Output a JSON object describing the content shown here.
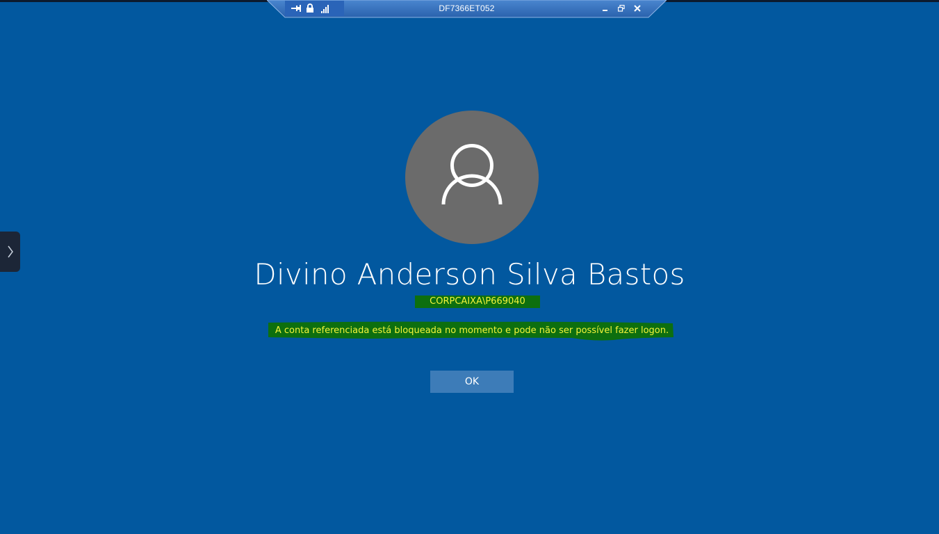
{
  "rdp_bar": {
    "title": "DF7366ET052",
    "icons": [
      "pin-icon",
      "lock-icon",
      "signal-icon",
      "minimize-icon",
      "restore-icon",
      "close-icon"
    ]
  },
  "login": {
    "user_name": "Divino Anderson Silva Bastos",
    "account_id": "CORPCAIXA\\P669040",
    "message": "A conta referenciada está bloqueada no momento e pode não ser possível fazer logon.",
    "ok_label": "OK"
  },
  "colors": {
    "background": "#02589f",
    "avatar": "#6b6b6b",
    "highlight_green": "#0d6f0f",
    "highlight_text": "#f4f43a",
    "ok_button": "#3d7cb8"
  }
}
